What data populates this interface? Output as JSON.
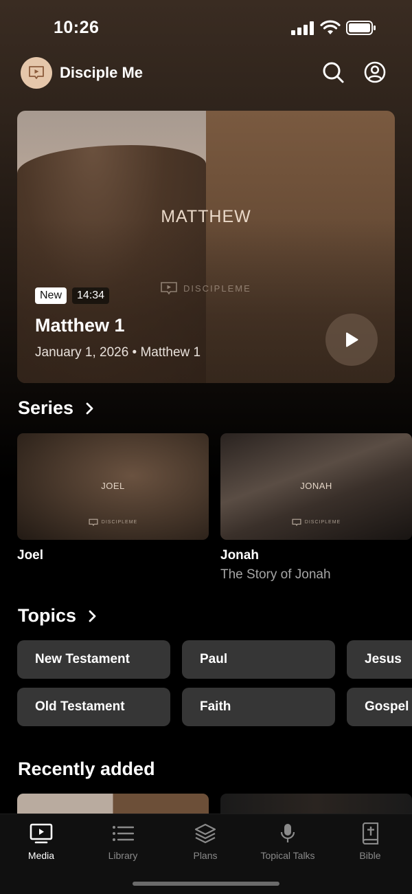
{
  "status": {
    "time": "10:26"
  },
  "header": {
    "title": "Disciple Me"
  },
  "hero": {
    "book_title": "MATTHEW",
    "watermark": "DISCIPLEME",
    "badge_new": "New",
    "duration": "14:34",
    "title": "Matthew 1",
    "meta": "January 1, 2026 • Matthew 1"
  },
  "series": {
    "title": "Series",
    "items": [
      {
        "thumb_text": "JOEL",
        "watermark": "DISCIPLEME",
        "name": "Joel",
        "subtitle": ""
      },
      {
        "thumb_text": "JONAH",
        "watermark": "DISCIPLEME",
        "name": "Jonah",
        "subtitle": "The Story of Jonah"
      }
    ]
  },
  "topics": {
    "title": "Topics",
    "chips": [
      "New Testament",
      "Paul",
      "Jesus",
      "Old Testament",
      "Faith",
      "Gospel"
    ]
  },
  "recent": {
    "title": "Recently added"
  },
  "tabs": [
    {
      "label": "Media",
      "icon": "tv-play-icon",
      "active": true
    },
    {
      "label": "Library",
      "icon": "list-icon",
      "active": false
    },
    {
      "label": "Plans",
      "icon": "layers-icon",
      "active": false
    },
    {
      "label": "Topical Talks",
      "icon": "microphone-icon",
      "active": false
    },
    {
      "label": "Bible",
      "icon": "bible-icon",
      "active": false
    }
  ]
}
